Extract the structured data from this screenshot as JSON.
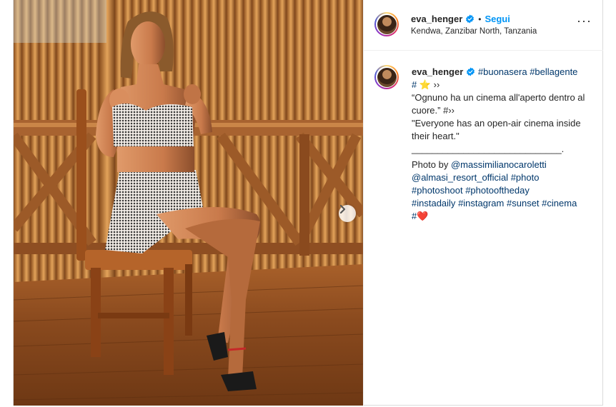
{
  "post": {
    "username": "eva_henger",
    "follow_label": "Segui",
    "separator": "•",
    "location": "Kendwa, Zanzibar North, Tanzania",
    "more_label": "···",
    "next_icon": "chevron-right-icon"
  },
  "caption": {
    "username": "eva_henger",
    "tag1": "#buonasera",
    "tag2": "#bellagente",
    "line2_hash": "#",
    "line2_star": "⭐",
    "line2_arrows": "››",
    "italian_quote": "“Ognuno ha un cinema all'aperto dentro al cuore.”",
    "italian_suffix": "#››",
    "english_quote": "\"Everyone has an open-air cinema inside their heart.\"",
    "divider": "_____________________________.",
    "photo_by": "Photo by",
    "credit1": "@massimilianocaroletti",
    "credit2": "@almasi_resort_official",
    "tag_photo": "#photo",
    "tag_photoshoot": "#photoshoot",
    "tag_photooftheday": "#photooftheday",
    "tag_instadaily": "#instadaily",
    "tag_instagram": "#instagram",
    "tag_sunset": "#sunset",
    "tag_cinema": "#cinema",
    "last_hash": "#",
    "heart": "❤️"
  },
  "colors": {
    "link": "#00376b",
    "follow": "#0095f6",
    "verified": "#0095f6"
  }
}
